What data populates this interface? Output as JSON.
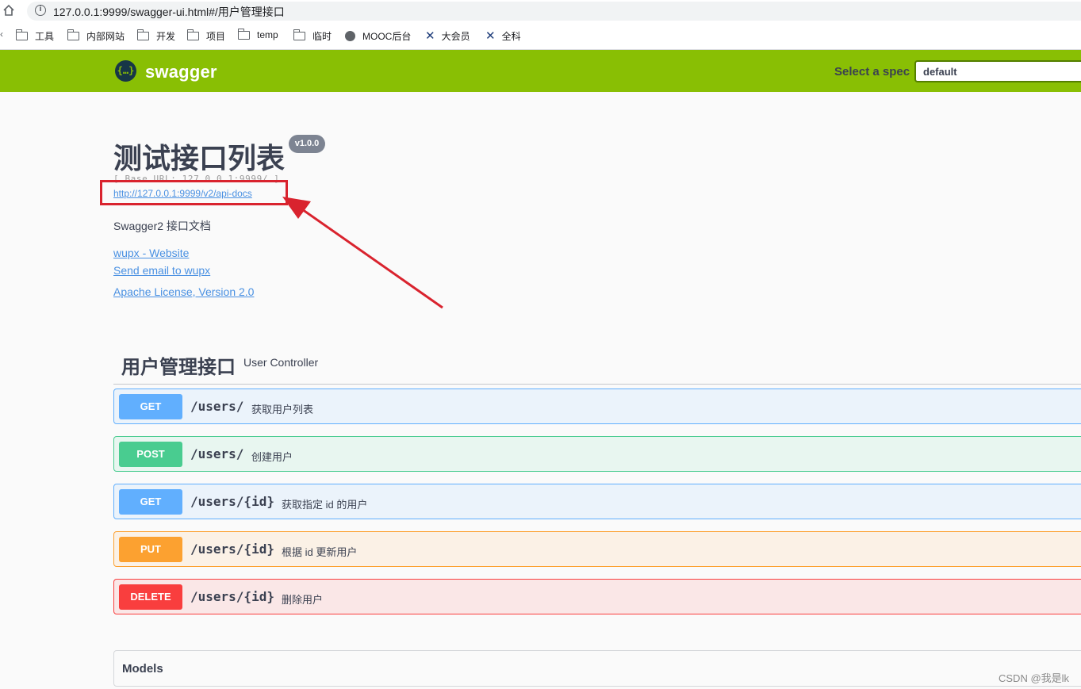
{
  "browser": {
    "url": "127.0.0.1:9999/swagger-ui.html#/用户管理接口",
    "bookmarks": [
      {
        "label": "工具",
        "icon": "folder-icon"
      },
      {
        "label": "内部网站",
        "icon": "folder-icon"
      },
      {
        "label": "开发",
        "icon": "folder-icon"
      },
      {
        "label": "项目",
        "icon": "folder-icon"
      },
      {
        "label": "temp",
        "icon": "folder-icon"
      },
      {
        "label": "临时",
        "icon": "folder-icon"
      },
      {
        "label": "MOOC后台",
        "icon": "globe-icon"
      },
      {
        "label": "大会员",
        "icon": "app-x-icon"
      },
      {
        "label": "全科",
        "icon": "app-x-icon"
      }
    ]
  },
  "topbar": {
    "logo_text": "swagger",
    "spec_label": "Select a spec",
    "spec_value": "default"
  },
  "info": {
    "title": "测试接口列表",
    "version": "v1.0.0",
    "base_url": "[ Base URL: 127.0.0.1:9999/ ]",
    "docs_url": "http://127.0.0.1:9999/v2/api-docs",
    "description": "Swagger2 接口文档",
    "links": [
      "wupx - Website",
      "Send email to wupx",
      "Apache License, Version 2.0"
    ]
  },
  "tag": {
    "name": "用户管理接口",
    "description": "User Controller"
  },
  "operations": [
    {
      "method": "GET",
      "path": "/users/",
      "summary": "获取用户列表"
    },
    {
      "method": "POST",
      "path": "/users/",
      "summary": "创建用户"
    },
    {
      "method": "GET",
      "path": "/users/{id}",
      "summary": "获取指定 id 的用户"
    },
    {
      "method": "PUT",
      "path": "/users/{id}",
      "summary": "根据 id 更新用户"
    },
    {
      "method": "DELETE",
      "path": "/users/{id}",
      "summary": "删除用户"
    }
  ],
  "models": {
    "title": "Models"
  },
  "watermark": "CSDN @我是lk",
  "colors": {
    "topbar": "#89bf04",
    "get": "#61affe",
    "post": "#49cc90",
    "put": "#fca130",
    "delete": "#f93e3e",
    "annotation": "#d9232e"
  }
}
